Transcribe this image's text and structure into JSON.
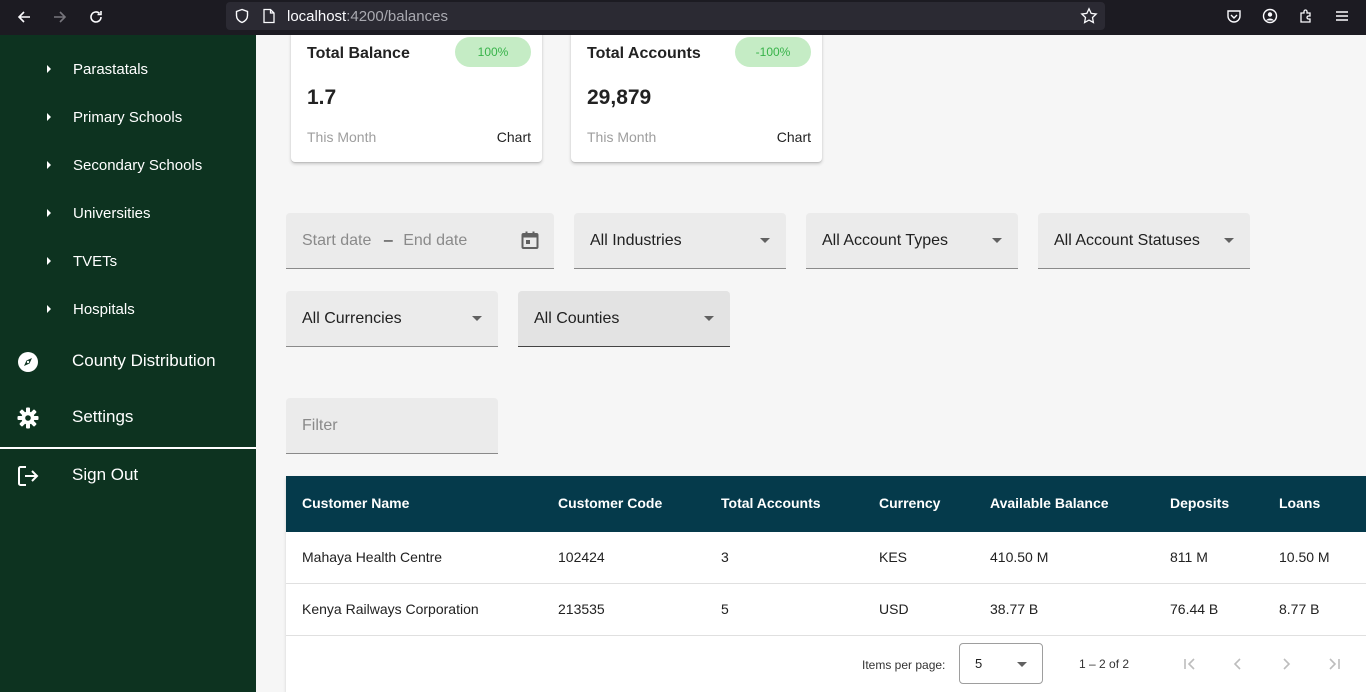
{
  "browser": {
    "url_host": "localhost",
    "url_path": ":4200/balances"
  },
  "sidebar": {
    "sub_items": [
      {
        "label": "Parastatals"
      },
      {
        "label": "Primary Schools"
      },
      {
        "label": "Secondary Schools"
      },
      {
        "label": "Universities"
      },
      {
        "label": "TVETs"
      },
      {
        "label": "Hospitals"
      }
    ],
    "county_distribution": "County Distribution",
    "settings": "Settings",
    "sign_out": "Sign Out"
  },
  "cards": [
    {
      "title": "Total Balance",
      "badge": "100%",
      "value": "1.7",
      "period": "This Month",
      "link": "Chart"
    },
    {
      "title": "Total Accounts",
      "badge": "-100%",
      "value": "29,879",
      "period": "This Month",
      "link": "Chart"
    }
  ],
  "filters": {
    "start_date_placeholder": "Start date",
    "date_separator": "–",
    "end_date_placeholder": "End date",
    "industry": "All Industries",
    "account_type": "All Account Types",
    "account_status": "All Account Statuses",
    "currency": "All Currencies",
    "county": "All Counties",
    "filter_placeholder": "Filter"
  },
  "table": {
    "columns": [
      "Customer Name",
      "Customer Code",
      "Total Accounts",
      "Currency",
      "Available Balance",
      "Deposits",
      "Loans"
    ],
    "rows": [
      [
        "Mahaya Health Centre",
        "102424",
        "3",
        "KES",
        "410.50 M",
        "811 M",
        "10.50 M"
      ],
      [
        "Kenya Railways Corporation",
        "213535",
        "5",
        "USD",
        "38.77 B",
        "76.44 B",
        "8.77 B"
      ]
    ]
  },
  "paginator": {
    "items_per_page_label": "Items per page:",
    "page_size": "5",
    "range_label": "1 – 2 of 2"
  },
  "colors": {
    "sidebar_bg": "#0d3320",
    "table_header_bg": "#053a4b",
    "badge_bg": "#c5ecc5",
    "badge_text": "#38b34a"
  }
}
